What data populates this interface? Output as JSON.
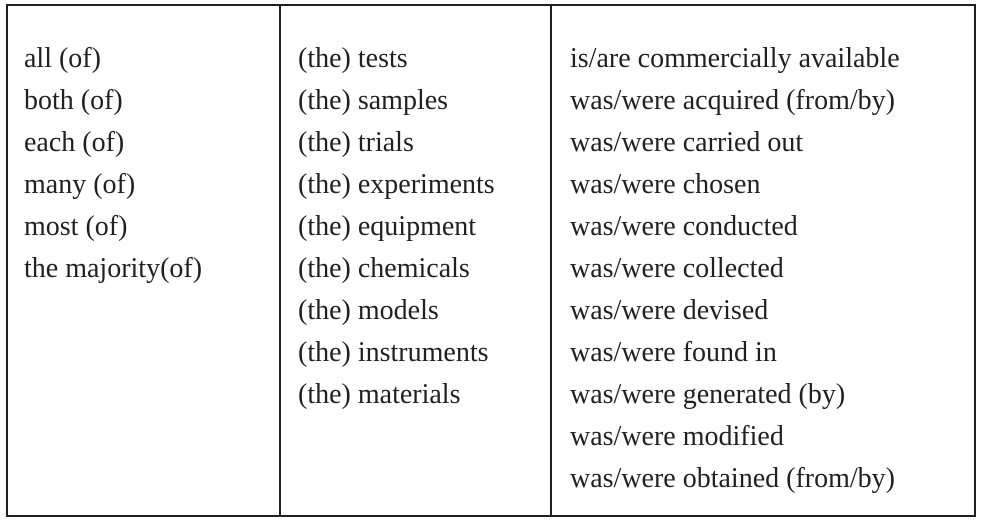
{
  "table": {
    "quantifiers": [
      "all (of)",
      "both (of)",
      "each (of)",
      "many (of)",
      "most (of)",
      "the majority(of)"
    ],
    "nouns": [
      "(the) tests",
      "(the) samples",
      "(the) trials",
      "(the) experiments",
      "(the) equipment",
      "(the) chemicals",
      "(the) models",
      "(the) instruments",
      "(the) materials"
    ],
    "verbs": [
      "is/are commercially available",
      "was/were acquired (from/by)",
      "was/were carried out",
      "was/were chosen",
      "was/were conducted",
      "was/were collected",
      "was/were devised",
      "was/were found in",
      "was/were generated (by)",
      "was/were modified",
      "was/were obtained (from/by)"
    ]
  }
}
